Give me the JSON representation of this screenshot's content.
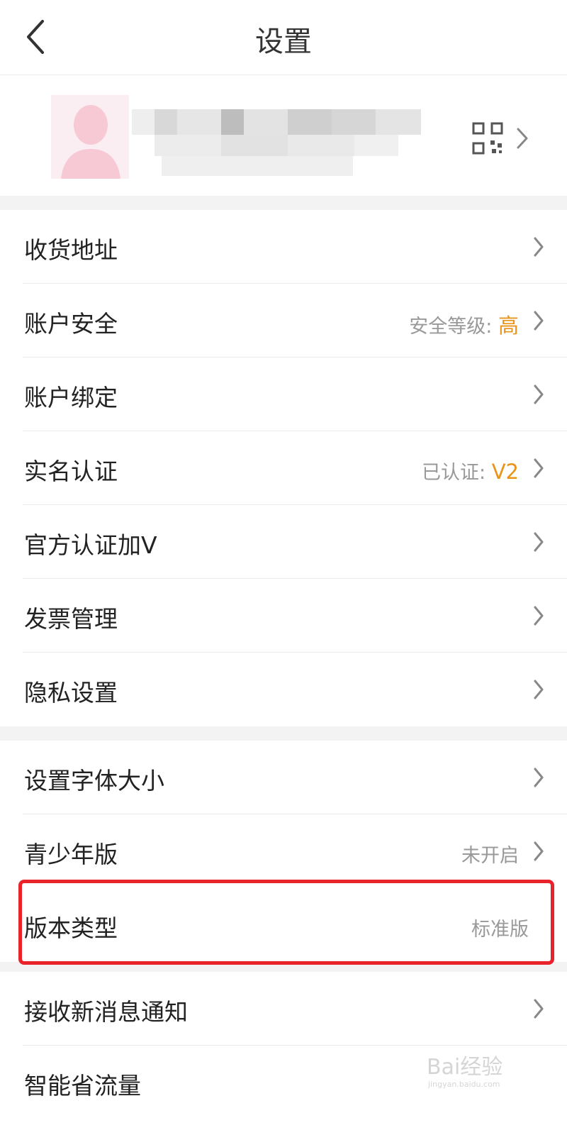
{
  "header": {
    "title": "设置",
    "back_icon": "chevron-left-icon"
  },
  "profile": {
    "avatar_icon": "default-avatar-icon",
    "qr_icon": "qr-code-icon",
    "chevron_icon": "chevron-right-icon"
  },
  "colors": {
    "accent": "#e8941b",
    "highlight_border": "#e8232a",
    "secondary_text": "#999999",
    "section_gap": "#f3f3f3"
  },
  "group1": [
    {
      "label": "收货地址"
    },
    {
      "label": "账户安全",
      "value_prefix": "安全等级:",
      "value_highlight": "高"
    },
    {
      "label": "账户绑定"
    },
    {
      "label": "实名认证",
      "value_prefix": "已认证:",
      "value_highlight": "V2"
    },
    {
      "label": "官方认证加V"
    },
    {
      "label": "发票管理"
    },
    {
      "label": "隐私设置"
    }
  ],
  "group2": [
    {
      "label": "设置字体大小"
    },
    {
      "label": "青少年版",
      "value": "未开启"
    },
    {
      "label": "版本类型",
      "value": "标准版"
    }
  ],
  "group3": [
    {
      "label": "接收新消息通知"
    },
    {
      "label": "智能省流量"
    }
  ],
  "watermark": {
    "text": "Bai经验",
    "subtext": "jingyan.baidu.com"
  }
}
